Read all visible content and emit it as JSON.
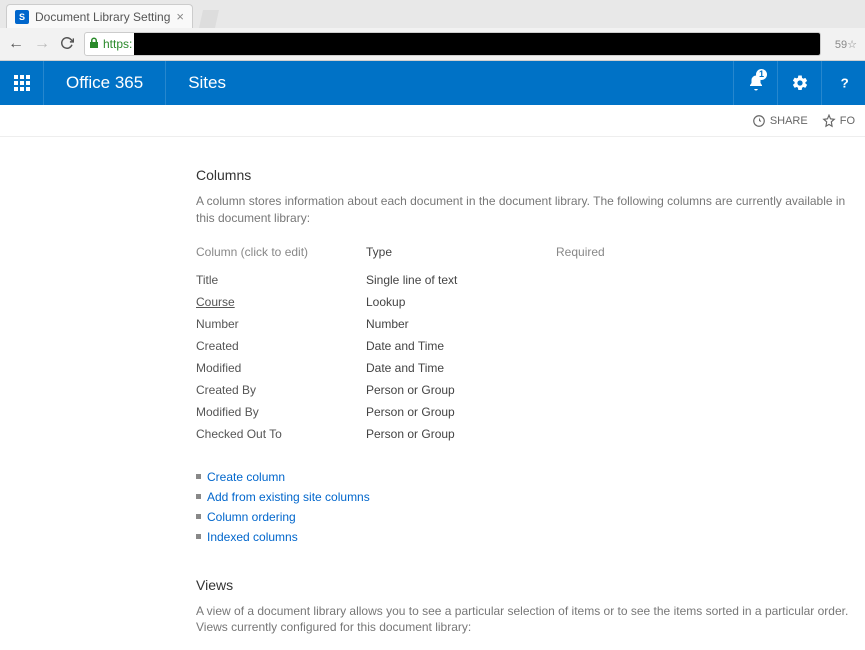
{
  "browser": {
    "tab_title": "Document Library Setting",
    "https_label": "https:",
    "url_suffix": "59☆"
  },
  "suite": {
    "brand": "Office 365",
    "app": "Sites",
    "notification_count": "1"
  },
  "actions": {
    "share": "SHARE",
    "follow": "FO"
  },
  "columns_section": {
    "title": "Columns",
    "description": "A column stores information about each document in the document library. The following columns are currently available in this document library:",
    "header_col": "Column (click to edit)",
    "header_type": "Type",
    "header_required": "Required",
    "rows": [
      {
        "name": "Title",
        "type": "Single line of text",
        "required": "",
        "underlined": false
      },
      {
        "name": "Course",
        "type": "Lookup",
        "required": "",
        "underlined": true
      },
      {
        "name": "Number",
        "type": "Number",
        "required": "",
        "underlined": false
      },
      {
        "name": "Created",
        "type": "Date and Time",
        "required": "",
        "underlined": false
      },
      {
        "name": "Modified",
        "type": "Date and Time",
        "required": "",
        "underlined": false
      },
      {
        "name": "Created By",
        "type": "Person or Group",
        "required": "",
        "underlined": false
      },
      {
        "name": "Modified By",
        "type": "Person or Group",
        "required": "",
        "underlined": false
      },
      {
        "name": "Checked Out To",
        "type": "Person or Group",
        "required": "",
        "underlined": false
      }
    ],
    "links": {
      "create": "Create column",
      "add_existing": "Add from existing site columns",
      "ordering": "Column ordering",
      "indexed": "Indexed columns"
    }
  },
  "views_section": {
    "title": "Views",
    "description": "A view of a document library allows you to see a particular selection of items or to see the items sorted in a particular order. Views currently configured for this document library:"
  }
}
